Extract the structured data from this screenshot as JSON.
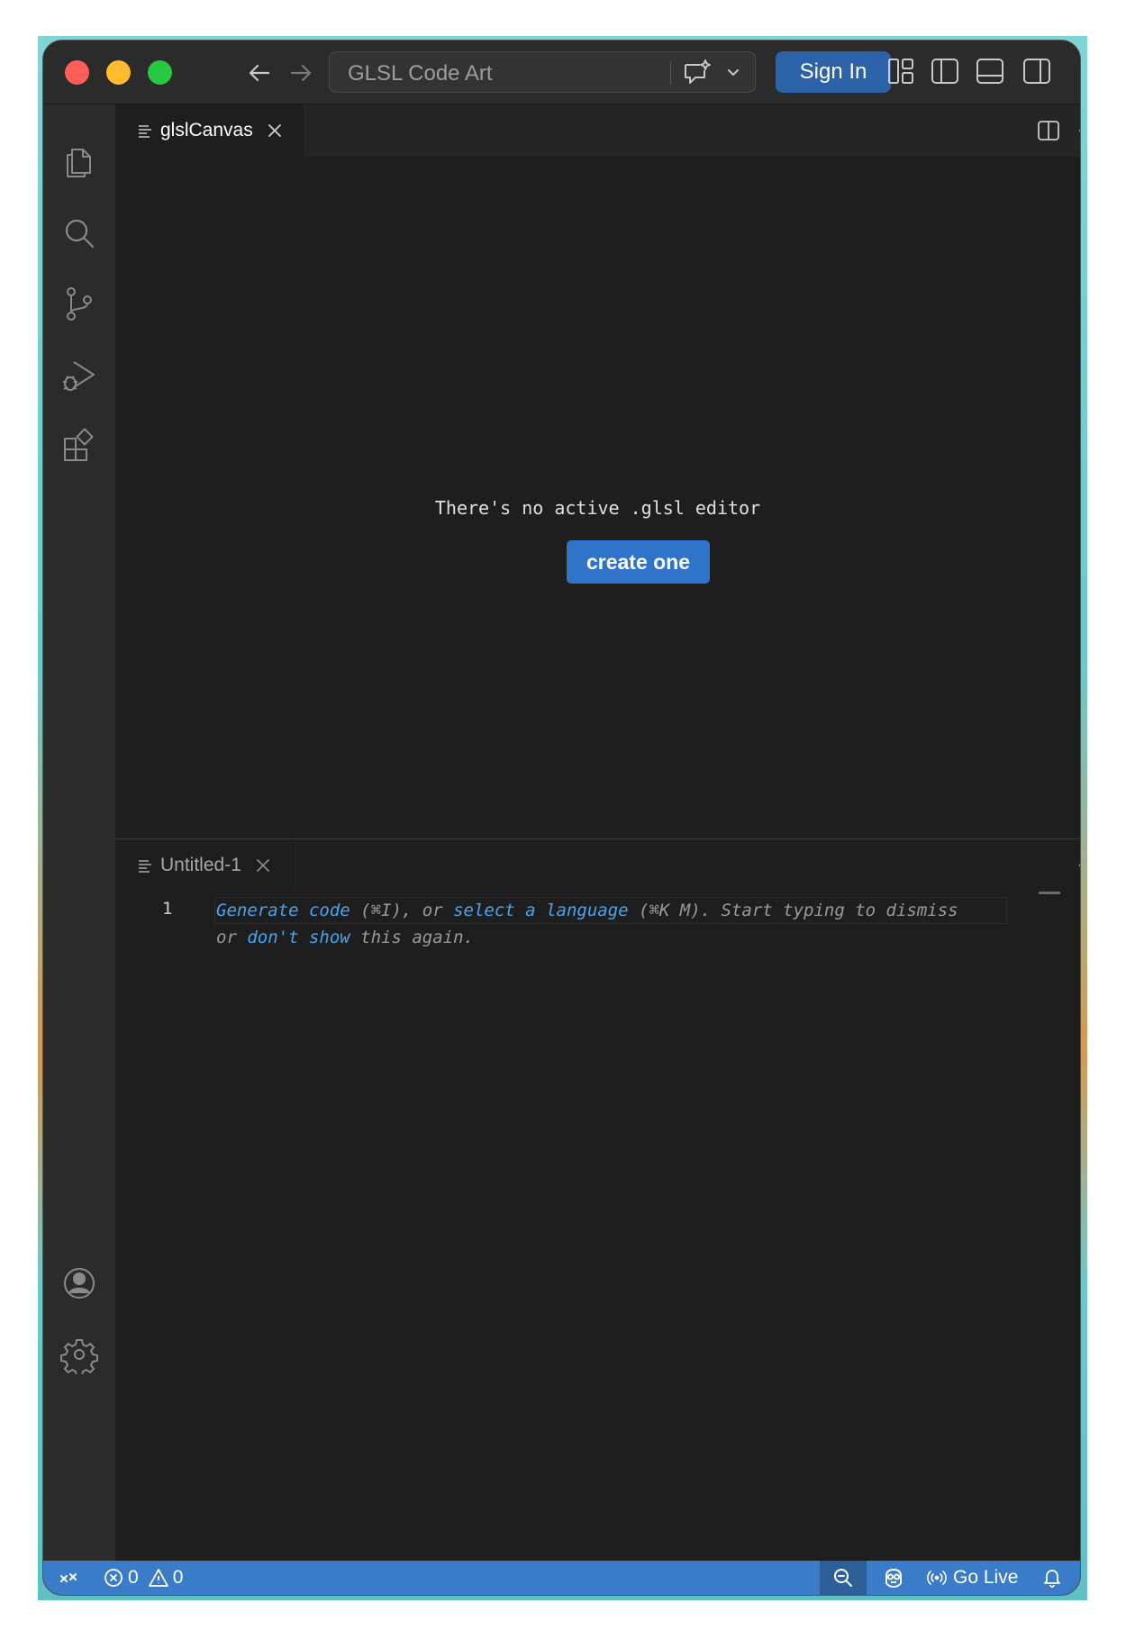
{
  "titlebar": {
    "search_text": "GLSL Code Art",
    "signin_label": "Sign In"
  },
  "editor_top": {
    "tab_label": "glslCanvas",
    "message": "There's no active .glsl editor",
    "button_label": "create one"
  },
  "editor_bottom": {
    "tab_label": "Untitled-1",
    "line_number": "1",
    "hint": {
      "generate_code": "Generate code",
      "shortcut1": " (⌘I), or ",
      "select_language": "select a language",
      "shortcut2": " (⌘K M). Start typing to dismiss",
      "or": "or ",
      "dont_show": "don't show",
      "again": " this again."
    }
  },
  "statusbar": {
    "errors": "0",
    "warnings": "0",
    "go_live": "Go Live"
  },
  "colors": {
    "accent": "#2f74c9",
    "statusbar": "#3a7cc7",
    "signin": "#2c62a8",
    "link": "#4aa3f0"
  },
  "icons": {
    "activitybar": [
      "files-icon",
      "search-icon",
      "source-control-icon",
      "run-debug-icon",
      "extensions-icon",
      "account-icon",
      "settings-gear-icon"
    ],
    "titlebar": [
      "back-arrow-icon",
      "forward-arrow-icon",
      "chat-sparkle-icon",
      "chevron-down-icon",
      "customize-layout-icon",
      "toggle-primary-sidebar-icon",
      "toggle-panel-icon",
      "toggle-secondary-sidebar-icon"
    ]
  }
}
